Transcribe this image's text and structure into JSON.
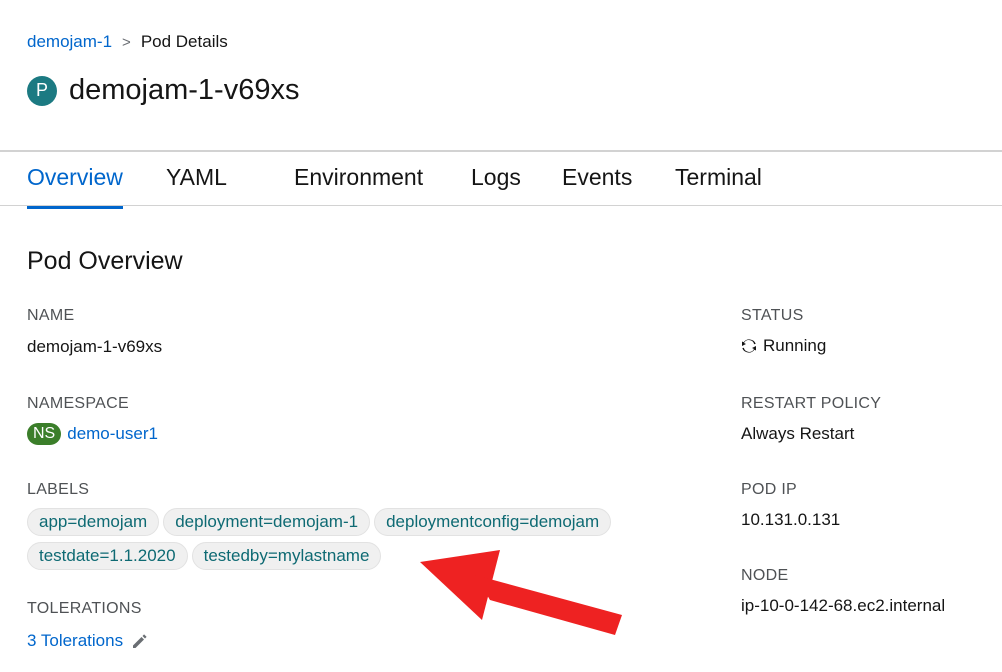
{
  "breadcrumb": {
    "parent": "demojam-1",
    "separator": ">",
    "current": "Pod Details"
  },
  "header": {
    "badge": "P",
    "title": "demojam-1-v69xs"
  },
  "tabs": [
    {
      "label": "Overview",
      "active": true
    },
    {
      "label": "YAML"
    },
    {
      "label": "Environment"
    },
    {
      "label": "Logs"
    },
    {
      "label": "Events"
    },
    {
      "label": "Terminal"
    }
  ],
  "overview": {
    "section_title": "Pod Overview",
    "name": {
      "label": "NAME",
      "value": "demojam-1-v69xs"
    },
    "namespace": {
      "label": "NAMESPACE",
      "badge": "NS",
      "value": "demo-user1"
    },
    "labels": {
      "label": "LABELS",
      "items": [
        "app=demojam",
        "deployment=demojam-1",
        "deploymentconfig=demojam",
        "testdate=1.1.2020",
        "testedby=mylastname"
      ]
    },
    "tolerations": {
      "label": "TOLERATIONS",
      "value": "3 Tolerations",
      "icon": "pencil-icon"
    },
    "status": {
      "label": "STATUS",
      "value": "Running",
      "icon": "sync-icon"
    },
    "restart_policy": {
      "label": "RESTART POLICY",
      "value": "Always Restart"
    },
    "pod_ip": {
      "label": "POD IP",
      "value": "10.131.0.131"
    },
    "node": {
      "label": "NODE",
      "value": "ip-10-0-142-68.ec2.internal"
    }
  },
  "colors": {
    "link": "#0066cc",
    "pod_badge": "#1c7a82",
    "ns_badge": "#3b7e2a",
    "label_text": "#0e6a73",
    "annotation_arrow": "#ee2222"
  }
}
